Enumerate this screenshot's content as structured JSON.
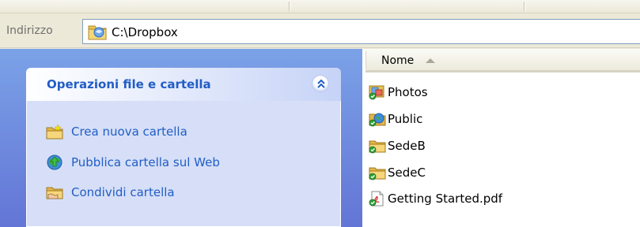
{
  "address_bar": {
    "label": "Indirizzo",
    "path": "C:\\Dropbox"
  },
  "task_pane": {
    "title": "Operazioni file e cartella",
    "items": [
      {
        "label": "Crea nuova cartella",
        "icon": "new-folder-icon"
      },
      {
        "label": "Pubblica cartella sul Web",
        "icon": "publish-web-icon"
      },
      {
        "label": "Condividi cartella",
        "icon": "share-folder-icon"
      }
    ]
  },
  "file_list": {
    "column_name": "Nome",
    "sort": "ascending",
    "files": [
      {
        "name": "Photos",
        "icon": "photos-folder-icon"
      },
      {
        "name": "Public",
        "icon": "public-folder-icon"
      },
      {
        "name": "SedeB",
        "icon": "folder-icon"
      },
      {
        "name": "SedeC",
        "icon": "folder-icon"
      },
      {
        "name": "Getting Started.pdf",
        "icon": "pdf-icon"
      }
    ]
  },
  "colors": {
    "pane_gradient_top": "#7ba2e7",
    "pane_gradient_bottom": "#6375d6",
    "task_link": "#215dc6",
    "sync_check": "#2fa33a"
  }
}
